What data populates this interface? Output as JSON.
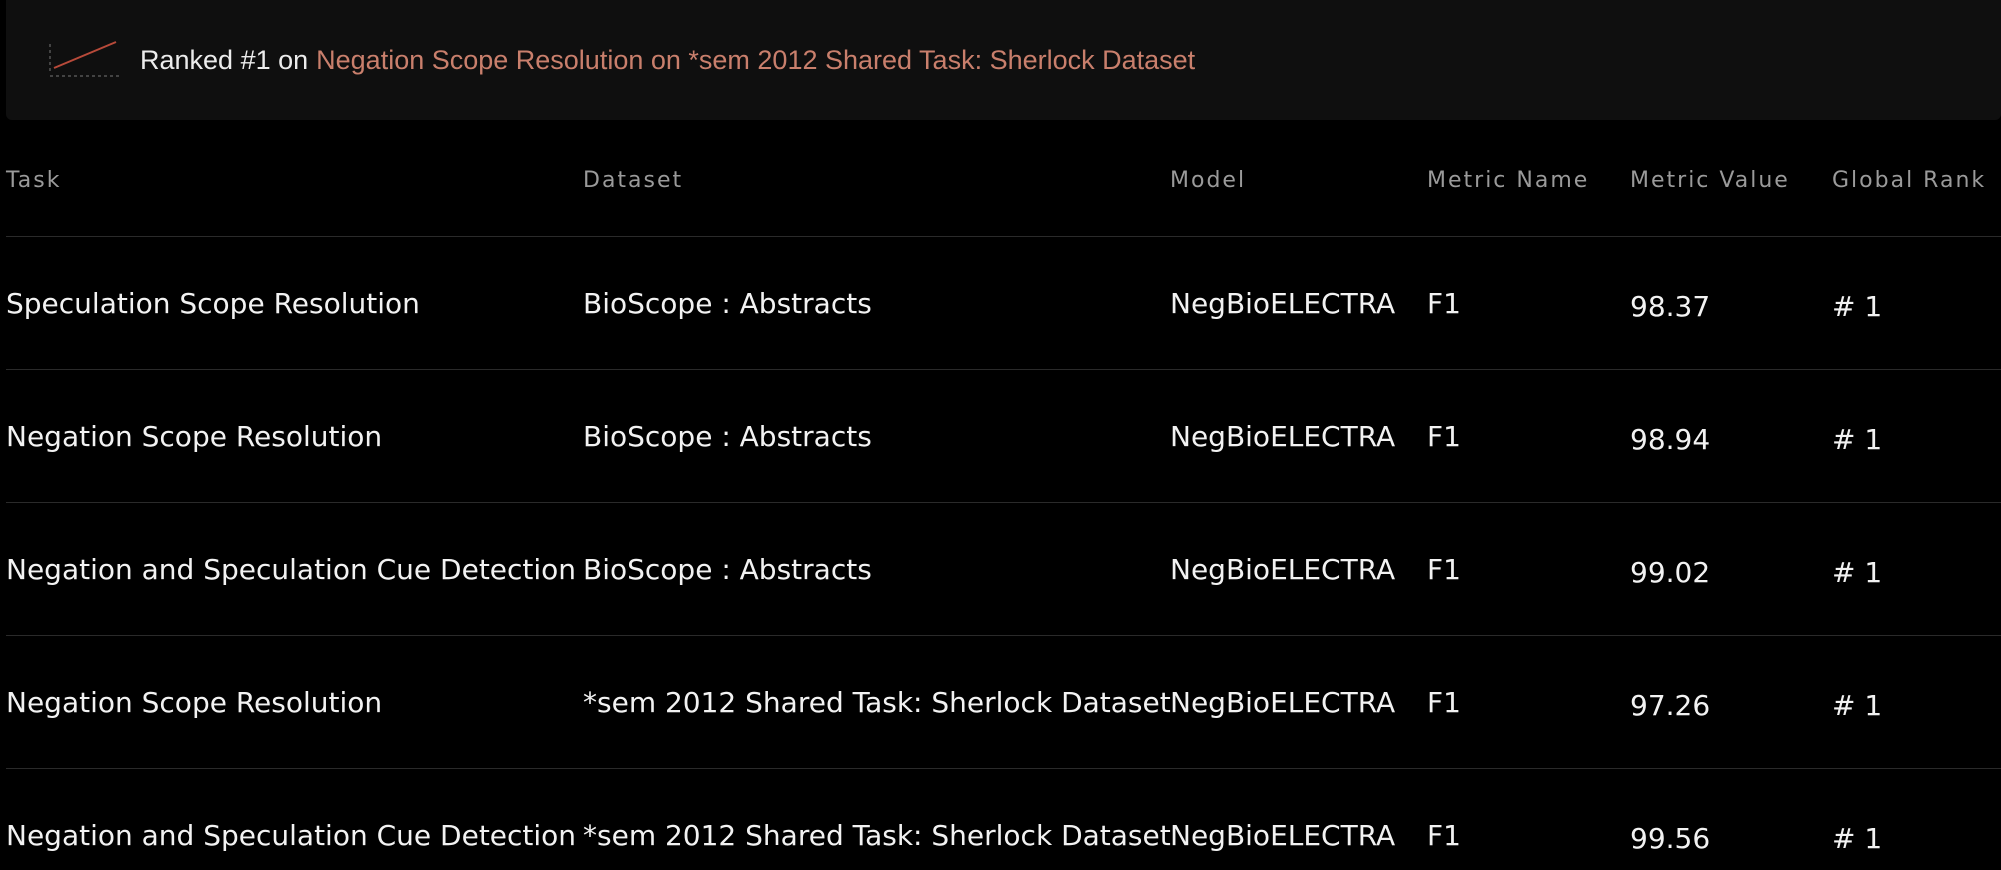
{
  "banner": {
    "icon": "sparkline-chart-icon",
    "prefix": "Ranked #1 on",
    "link_text": "Negation Scope Resolution on *sem 2012 Shared Task: Sherlock Dataset",
    "link_color": "#c97f6c"
  },
  "table": {
    "headers": {
      "task": "Task",
      "dataset": "Dataset",
      "model": "Model",
      "metric_name": "Metric Name",
      "metric_value": "Metric Value",
      "global_rank": "Global Rank"
    },
    "rows": [
      {
        "task": "Speculation Scope Resolution",
        "dataset": "BioScope : Abstracts",
        "model": "NegBioELECTRA",
        "metric_name": "F1",
        "metric_value": "98.37",
        "global_rank": "# 1"
      },
      {
        "task": "Negation Scope Resolution",
        "dataset": "BioScope : Abstracts",
        "model": "NegBioELECTRA",
        "metric_name": "F1",
        "metric_value": "98.94",
        "global_rank": "# 1"
      },
      {
        "task": "Negation and Speculation Cue Detection",
        "dataset": "BioScope : Abstracts",
        "model": "NegBioELECTRA",
        "metric_name": "F1",
        "metric_value": "99.02",
        "global_rank": "# 1"
      },
      {
        "task": "Negation Scope Resolution",
        "dataset": "*sem 2012 Shared Task: Sherlock Dataset",
        "model": "NegBioELECTRA",
        "metric_name": "F1",
        "metric_value": "97.26",
        "global_rank": "# 1"
      },
      {
        "task": "Negation and Speculation Cue Detection",
        "dataset": "*sem 2012 Shared Task: Sherlock Dataset",
        "model": "NegBioELECTRA",
        "metric_name": "F1",
        "metric_value": "99.56",
        "global_rank": "# 1"
      }
    ]
  }
}
